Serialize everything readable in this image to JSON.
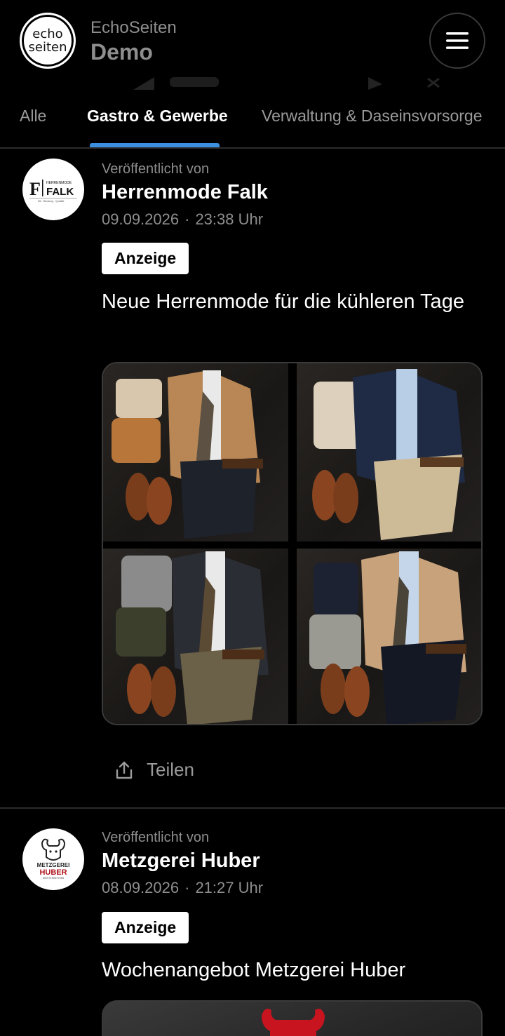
{
  "app": {
    "logo_line1": "echo",
    "logo_line2": "seiten",
    "brand_line1": "EchoSeiten",
    "brand_line2": "Demo",
    "menu_icon": "hamburger-icon"
  },
  "tabs": [
    {
      "label": "Alle",
      "active": false
    },
    {
      "label": "Gastro & Gewerbe",
      "active": true
    },
    {
      "label": "Verwaltung & Daseinsvorsorge",
      "active": false
    }
  ],
  "colors": {
    "accent": "#3d8fe0",
    "background": "#000000",
    "muted": "#8e8e8e"
  },
  "posts": [
    {
      "published_by_label": "Veröffentlicht von",
      "publisher": "Herrenmode Falk",
      "avatar_logo_lines": [
        "HERRENMODE",
        "FALK",
        "Stil · Beratung · Qualität"
      ],
      "date": "09.09.2026",
      "time": "23:38 Uhr",
      "badge": "Anzeige",
      "title": "Neue Herrenmode für die kühleren Tage",
      "share_label": "Teilen"
    },
    {
      "published_by_label": "Veröffentlicht von",
      "publisher": "Metzgerei Huber",
      "avatar_logo_lines": [
        "METZGEREI",
        "HUBER",
        "MEISTERBETRIEB"
      ],
      "date": "08.09.2026",
      "time": "21:27 Uhr",
      "badge": "Anzeige",
      "title": "Wochenangebot Metzgerei Huber"
    }
  ]
}
